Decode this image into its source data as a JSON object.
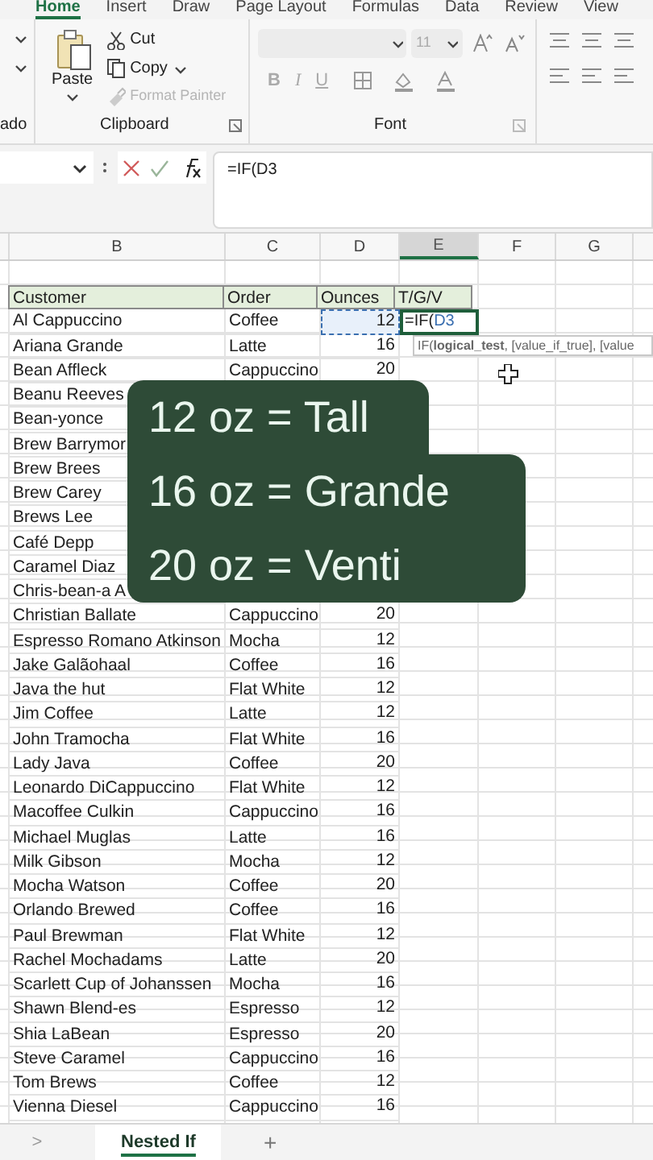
{
  "ribbon_tabs": [
    {
      "label": "Home",
      "selected": true
    },
    {
      "label": "Insert",
      "selected": false
    },
    {
      "label": "Draw",
      "selected": false
    },
    {
      "label": "Page Layout",
      "selected": false
    },
    {
      "label": "Formulas",
      "selected": false
    },
    {
      "label": "Data",
      "selected": false
    },
    {
      "label": "Review",
      "selected": false
    },
    {
      "label": "View",
      "selected": false
    }
  ],
  "ribbon": {
    "undo_group": {
      "label": "ado"
    },
    "clipboard": {
      "label": "Clipboard",
      "paste": "Paste",
      "cut": "Cut",
      "copy": "Copy",
      "format_painter": {
        "label": "Format Painter",
        "disabled": true
      }
    },
    "font": {
      "label": "Font",
      "font_size": "11",
      "disabled": true,
      "bold": "B",
      "italic": "I",
      "underline": "U"
    }
  },
  "formula_bar": {
    "formula_prefix": "=IF(",
    "formula_reference": "D3"
  },
  "columns": [
    {
      "label": "B",
      "selected": false
    },
    {
      "label": "C",
      "selected": false
    },
    {
      "label": "D",
      "selected": false
    },
    {
      "label": "E",
      "selected": true
    },
    {
      "label": "F",
      "selected": false
    },
    {
      "label": "G",
      "selected": false
    }
  ],
  "table": {
    "headers": [
      "Customer",
      "Order",
      "Ounces",
      "T/G/V"
    ],
    "rows": [
      {
        "customer": "Al Cappuccino",
        "order": "Coffee",
        "ounces": "12",
        "editing": {
          "prefix": "=IF(",
          "reference": "D3"
        }
      },
      {
        "customer": "Ariana Grande",
        "order": "Latte",
        "ounces": "16"
      },
      {
        "customer": "Bean Affleck",
        "order": "Cappuccino",
        "ounces": "20"
      },
      {
        "customer": "Beanu Reeves"
      },
      {
        "customer": "Bean-yonce"
      },
      {
        "customer": "Brew Barrymor"
      },
      {
        "customer": "Brew Brees"
      },
      {
        "customer": "Brew Carey"
      },
      {
        "customer": "Brews Lee"
      },
      {
        "customer": "Café Depp"
      },
      {
        "customer": "Caramel Diaz"
      },
      {
        "customer": "Chris-bean-a A"
      },
      {
        "customer": "Christian Ballate",
        "order": "Cappuccino",
        "ounces": "20"
      },
      {
        "customer": "Espresso Romano Atkinson",
        "order": "Mocha",
        "ounces": "12"
      },
      {
        "customer": "Jake Galãohaal",
        "order": "Coffee",
        "ounces": "16"
      },
      {
        "customer": "Java the hut",
        "order": "Flat White",
        "ounces": "12"
      },
      {
        "customer": "Jim Coffee",
        "order": "Latte",
        "ounces": "12"
      },
      {
        "customer": "John Tramocha",
        "order": "Flat White",
        "ounces": "16"
      },
      {
        "customer": "Lady Java",
        "order": "Coffee",
        "ounces": "20"
      },
      {
        "customer": "Leonardo DiCappuccino",
        "order": "Flat White",
        "ounces": "12"
      },
      {
        "customer": "Macoffee Culkin",
        "order": "Cappuccino",
        "ounces": "16"
      },
      {
        "customer": "Michael Muglas",
        "order": "Latte",
        "ounces": "16"
      },
      {
        "customer": "Milk Gibson",
        "order": "Mocha",
        "ounces": "12"
      },
      {
        "customer": "Mocha Watson",
        "order": "Coffee",
        "ounces": "20"
      },
      {
        "customer": "Orlando Brewed",
        "order": "Coffee",
        "ounces": "16"
      },
      {
        "customer": "Paul Brewman",
        "order": "Flat White",
        "ounces": "12"
      },
      {
        "customer": "Rachel Mochadams",
        "order": "Latte",
        "ounces": "20"
      },
      {
        "customer": "Scarlett Cup of Johanssen",
        "order": "Mocha",
        "ounces": "16"
      },
      {
        "customer": "Shawn Blend-es",
        "order": "Espresso",
        "ounces": "12"
      },
      {
        "customer": "Shia LaBean",
        "order": "Espresso",
        "ounces": "20"
      },
      {
        "customer": "Steve Caramel",
        "order": "Cappuccino",
        "ounces": "16"
      },
      {
        "customer": "Tom Brews",
        "order": "Coffee",
        "ounces": "12"
      },
      {
        "customer": "Vienna Diesel",
        "order": "Cappuccino",
        "ounces": "16"
      }
    ]
  },
  "tooltip": "IF(**logical_test**, [value_if_true], [value",
  "caption_lines": [
    "12 oz = Tall",
    "16 oz = Grande",
    "20 oz = Venti"
  ],
  "sheet_tabs": {
    "scroll": ">",
    "tabs": [
      {
        "label": "Nested If",
        "selected": true
      }
    ],
    "add": "+"
  }
}
